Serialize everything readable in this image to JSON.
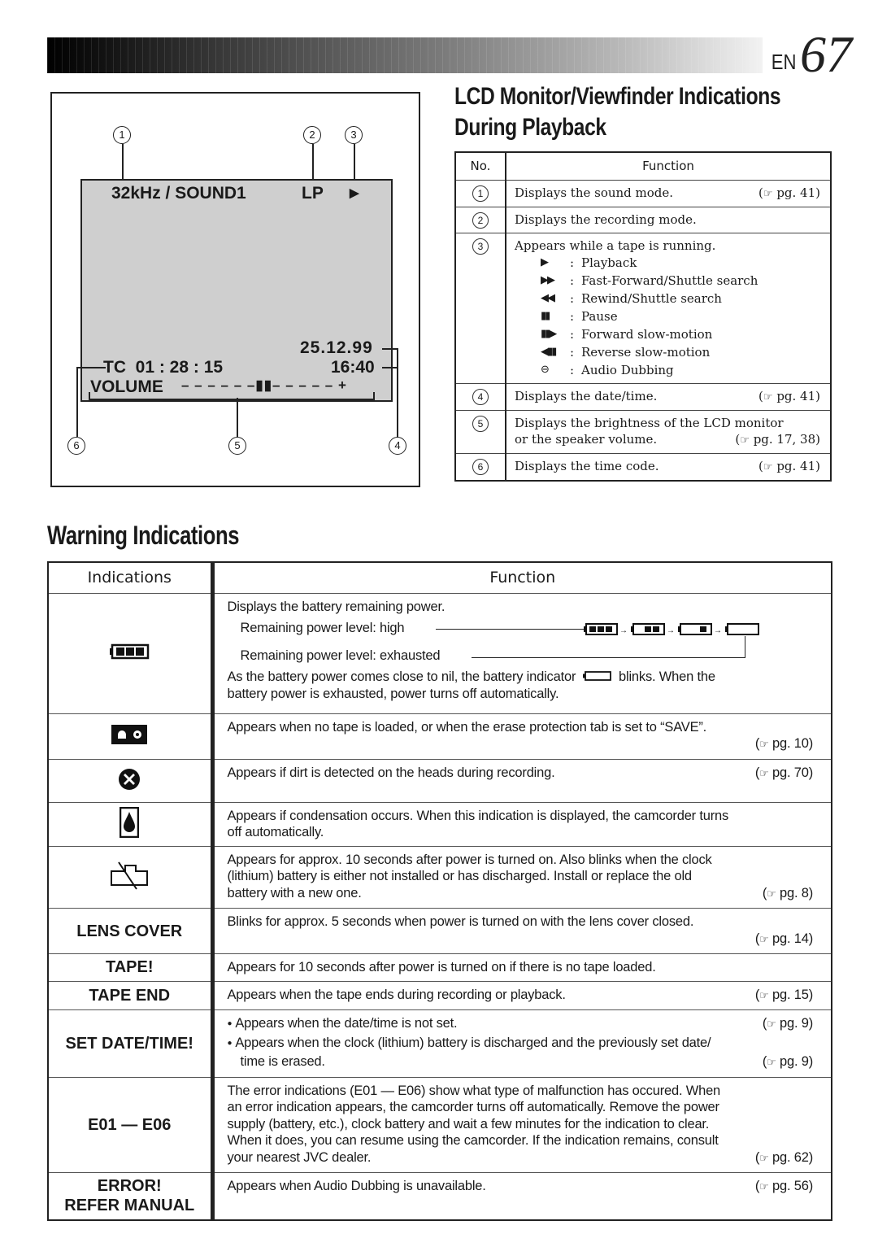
{
  "header": {
    "lang": "EN",
    "page_number": "67"
  },
  "lcd_section": {
    "title_line1": "LCD Monitor/Viewfinder Indications",
    "title_line2": "During Playback",
    "screen": {
      "sound_mode": "32kHz / SOUND1",
      "rec_mode": "LP",
      "tape_status_icon": "play-icon",
      "tape_status_glyph": "▶",
      "date": "25.12.99",
      "time": "16:40",
      "time_code": "TC  01 : 28 : 15",
      "volume_label": "VOLUME",
      "volume_scale": "– – – – – –▮▮– – – – – +",
      "volume_level_fraction": 0.5
    },
    "callouts": [
      "1",
      "2",
      "3",
      "4",
      "5",
      "6"
    ],
    "table": {
      "headers": {
        "no": "No.",
        "function": "Function"
      },
      "rows": [
        {
          "no": "1",
          "text": "Displays the sound mode.",
          "ref": "pg. 41"
        },
        {
          "no": "2",
          "text": "Displays the recording mode.",
          "ref": ""
        },
        {
          "no": "3",
          "text": "Appears while a tape is running.",
          "ref": "",
          "symbols": [
            {
              "icon": "play-icon",
              "glyph": "▶",
              "label": "Playback"
            },
            {
              "icon": "fast-forward-icon",
              "glyph": "▶▶",
              "label": "Fast-Forward/Shuttle search"
            },
            {
              "icon": "rewind-icon",
              "glyph": "◀◀",
              "label": "Rewind/Shuttle search"
            },
            {
              "icon": "pause-icon",
              "glyph": "▮▮",
              "label": "Pause"
            },
            {
              "icon": "forward-slow-icon",
              "glyph": "▮▮▶",
              "label": "Forward slow-motion"
            },
            {
              "icon": "reverse-slow-icon",
              "glyph": "◀▮▮",
              "label": "Reverse slow-motion"
            },
            {
              "icon": "audio-dubbing-icon",
              "glyph": "⊖",
              "label": "Audio Dubbing"
            }
          ]
        },
        {
          "no": "4",
          "text": "Displays the date/time.",
          "ref": "pg. 41"
        },
        {
          "no": "5",
          "text": "Displays the brightness of the LCD monitor",
          "text2": "or the speaker volume.",
          "ref": "pg. 17, 38"
        },
        {
          "no": "6",
          "text": "Displays the time code.",
          "ref": "pg. 41"
        }
      ]
    }
  },
  "warning_section": {
    "title": "Warning Indications",
    "headers": {
      "indications": "Indications",
      "function": "Function"
    },
    "rows": [
      {
        "icon": "battery-icon",
        "lines": [
          "Displays the battery remaining power."
        ],
        "level_high": "Remaining power level: high",
        "level_exhausted": "Remaining power level: exhausted",
        "battery_levels": [
          3,
          2,
          1,
          0
        ],
        "tail_before": "As the battery power comes close to nil, the battery indicator",
        "tail_after": "blinks. When the",
        "tail_line2": "battery power is exhausted, power turns off automatically."
      },
      {
        "icon": "cassette-icon",
        "lines": [
          "Appears when no tape is loaded, or when the erase protection tab is set to “SAVE”."
        ],
        "ref": "pg. 10"
      },
      {
        "icon": "head-dirt-icon",
        "lines": [
          "Appears if dirt is detected on the heads during recording."
        ],
        "ref": "pg. 70",
        "ref_inline": true
      },
      {
        "icon": "condensation-icon",
        "lines": [
          "Appears if condensation occurs. When this indication is displayed, the camcorder turns",
          "off automatically."
        ]
      },
      {
        "icon": "clock-battery-icon",
        "lines": [
          "Appears for approx. 10 seconds after power is turned on. Also blinks when the clock",
          "(lithium) battery is either not installed or has discharged. Install or replace the old",
          "battery with a new one."
        ],
        "ref": "pg. 8",
        "ref_inline": true
      },
      {
        "label": "LENS COVER",
        "lines": [
          "Blinks for approx. 5 seconds when power is turned on with the lens cover closed."
        ],
        "ref": "pg. 14"
      },
      {
        "label": "TAPE!",
        "lines": [
          "Appears for 10 seconds after power is turned on if there is no tape loaded."
        ]
      },
      {
        "label": "TAPE END",
        "lines": [
          "Appears when the tape ends during recording or playback."
        ],
        "ref": "pg. 15",
        "ref_inline": true
      },
      {
        "label": "SET DATE/TIME!",
        "bullets": [
          {
            "text": "Appears when the date/time is not set.",
            "ref": "pg. 9"
          },
          {
            "text": "Appears when the clock (lithium) battery is discharged and the previously set date/",
            "text2": "time is erased.",
            "ref": "pg. 9"
          }
        ]
      },
      {
        "label": "E01 — E06",
        "lines": [
          "The error indications (E01 — E06) show what type of malfunction has occured. When",
          "an error indication appears, the camcorder turns off automatically. Remove the power",
          "supply (battery, etc.), clock battery and wait a few minutes for the indication to clear.",
          "When it does, you can resume using the camcorder. If the indication remains, consult",
          "your nearest JVC dealer."
        ],
        "ref": "pg. 62",
        "ref_inline": true
      },
      {
        "label": "ERROR!",
        "label2": "REFER MANUAL",
        "lines": [
          "Appears when Audio Dubbing is unavailable."
        ],
        "ref": "pg. 56",
        "ref_inline": true
      }
    ]
  },
  "ref_symbol": "☞"
}
